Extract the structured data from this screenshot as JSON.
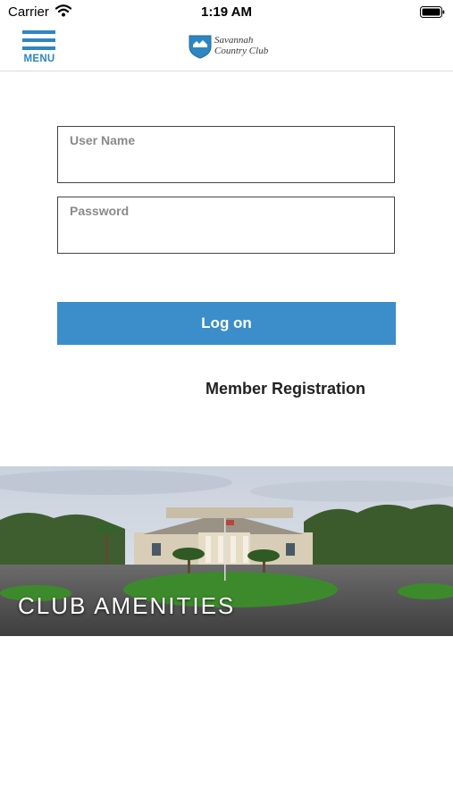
{
  "status_bar": {
    "carrier": "Carrier",
    "time": "1:19 AM",
    "icons": [
      "wifi-icon",
      "battery-icon"
    ]
  },
  "header": {
    "menu_label": "MENU",
    "logo_line1": "Savannah",
    "logo_line2": "Country Club",
    "accent_color": "#2e86c1"
  },
  "login": {
    "username_label": "User Name",
    "username_value": "",
    "password_label": "Password",
    "password_value": "",
    "logon_label": "Log on",
    "button_color": "#3b8ec9",
    "registration_link": "Member Registration"
  },
  "amenities": {
    "title": "CLUB AMENITIES",
    "image": "clubhouse-photo"
  }
}
